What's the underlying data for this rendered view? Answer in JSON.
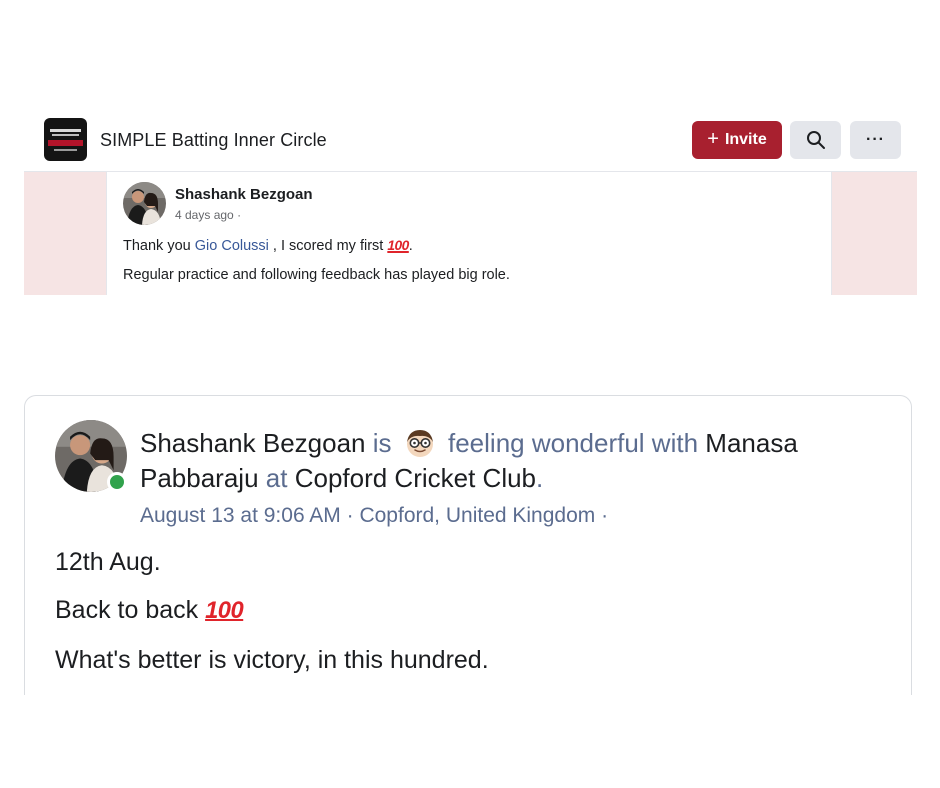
{
  "group_header": {
    "title": "SIMPLE Batting Inner Circle",
    "invite_label": "Invite",
    "search_icon": "search-icon",
    "more_label": "···",
    "invite_color": "#a8202f"
  },
  "post_small": {
    "author": "Shashank Bezgoan",
    "time": "4 days ago",
    "meta_sep": "·",
    "line1_before": "Thank you ",
    "line1_link": "Gio Colussi",
    "line1_after": " , I scored my first ",
    "line1_end": ".",
    "hundred": "100",
    "line2": "Regular practice and following feedback has played big role."
  },
  "post_large": {
    "author": "Shashank Bezgoan",
    "is": "is",
    "feeling": "feeling wonderful with",
    "tagged": "Manasa Pabbaraju",
    "at": "at",
    "place": "Copford Cricket Club",
    "period": ".",
    "meta": "August 13 at 9:06 AM · Copford, United Kingdom ·",
    "line1": "12th Aug.",
    "line2": "Back to back ",
    "hundred": "100",
    "line3": "What's better is victory, in this hundred.",
    "online_color": "#31a24c"
  }
}
